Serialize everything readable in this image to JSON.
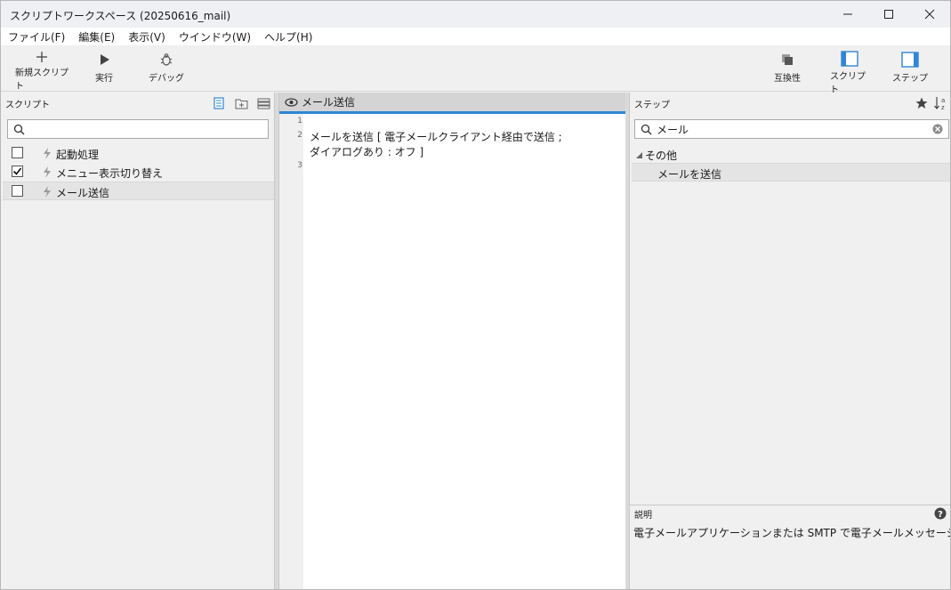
{
  "window": {
    "title": "スクリプトワークスペース (20250616_mail)"
  },
  "menu": [
    "ファイル(F)",
    "編集(E)",
    "表示(V)",
    "ウインドウ(W)",
    "ヘルプ(H)"
  ],
  "toolbar": {
    "new_script": "新規スクリプト",
    "run": "実行",
    "debug": "デバッグ",
    "compatibility": "互換性",
    "script": "スクリプト",
    "step": "ステップ"
  },
  "scripts_panel": {
    "title": "スクリプト",
    "search_value": "",
    "items": [
      {
        "label": "起動処理",
        "checked": false
      },
      {
        "label": "メニュー表示切り替え",
        "checked": true
      },
      {
        "label": "メール送信",
        "checked": false
      }
    ]
  },
  "editor": {
    "tab_label": "メール送信",
    "line_numbers": [
      "1",
      "2",
      "3"
    ],
    "lines": [
      "",
      "メールを送信 [ 電子メールクライアント経由で送信 ;",
      "ダイアログあり : オフ ]"
    ]
  },
  "steps_panel": {
    "title": "ステップ",
    "search_value": "メール",
    "category": "その他",
    "result": "メールを送信"
  },
  "description": {
    "title": "説明",
    "text": "電子メールアプリケーションまたは SMTP で電子メールメッセージを送信します。"
  },
  "colors": {
    "accent": "#2f86d4",
    "selected_row": "#e4e4e4"
  }
}
